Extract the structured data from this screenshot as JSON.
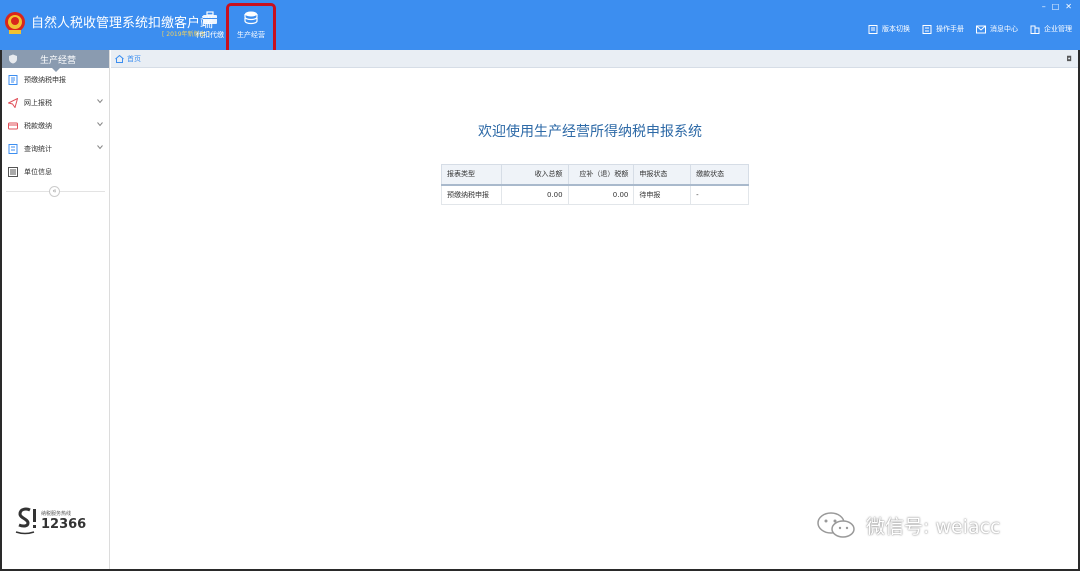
{
  "app": {
    "title": "自然人税收管理系统扣缴客户端",
    "subtitle": "[ 2019年新版本 ]"
  },
  "top_nav": [
    {
      "label": "代扣代缴",
      "icon": "briefcase-icon"
    },
    {
      "label": "生产经营",
      "icon": "coin-stack-icon",
      "highlighted": true
    }
  ],
  "right_tools": [
    {
      "label": "版本切换",
      "icon": "document-icon"
    },
    {
      "label": "操作手册",
      "icon": "manual-icon"
    },
    {
      "label": "消息中心",
      "icon": "envelope-icon"
    },
    {
      "label": "企业管理",
      "icon": "building-icon"
    }
  ],
  "window_controls": [
    "–",
    "□",
    "✕"
  ],
  "sidebar": {
    "header": "生产经营",
    "items": [
      {
        "label": "预缴纳税申报",
        "icon": "form-icon",
        "expandable": false
      },
      {
        "label": "网上报税",
        "icon": "paper-plane-icon",
        "expandable": true
      },
      {
        "label": "税款缴纳",
        "icon": "payment-icon",
        "expandable": true
      },
      {
        "label": "查询统计",
        "icon": "search-list-icon",
        "expandable": true
      },
      {
        "label": "单位信息",
        "icon": "company-info-icon",
        "expandable": false
      }
    ],
    "collapse": "«",
    "hotline": {
      "small": "纳税服务热线",
      "number": "12366"
    }
  },
  "tab": {
    "label": "首页"
  },
  "welcome": "欢迎使用生产经营所得纳税申报系统",
  "report_table": {
    "headers": [
      "报表类型",
      "收入总额",
      "应补（退）税额",
      "申报状态",
      "缴款状态"
    ],
    "rows": [
      [
        "预缴纳税申报",
        "0.00",
        "0.00",
        "待申报",
        "-"
      ]
    ]
  },
  "watermark": "微信号: weiacc",
  "colors": {
    "header": "#3c8ef0",
    "highlight": "#c8101e",
    "welcome": "#2e6aa7"
  }
}
